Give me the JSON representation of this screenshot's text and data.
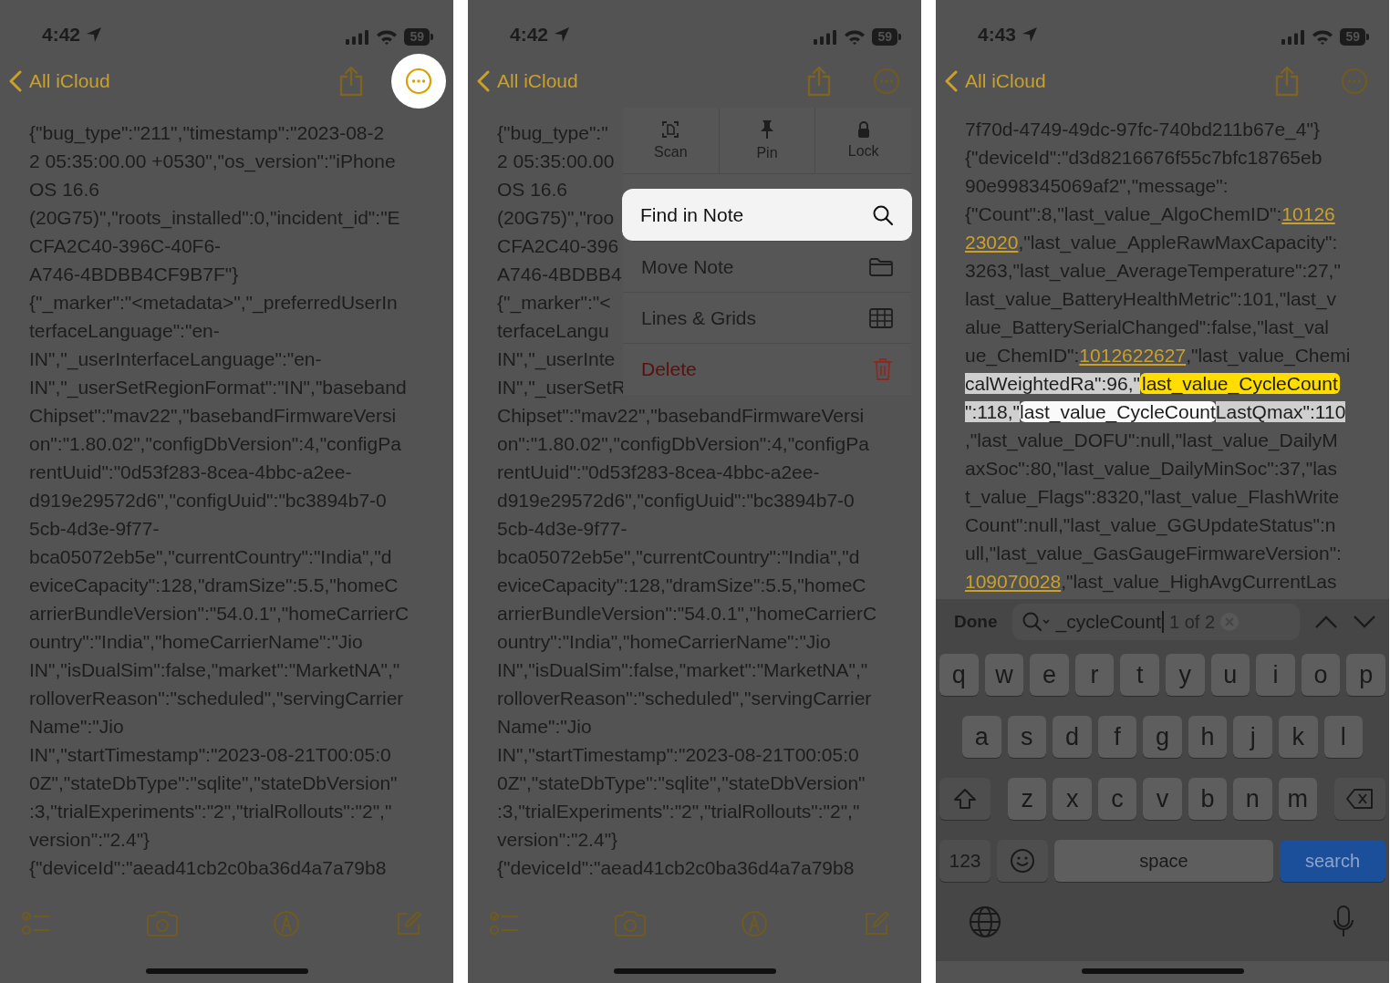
{
  "screens": [
    {
      "kind": "note",
      "status": {
        "time": "4:42",
        "battery": "59"
      },
      "nav": {
        "back": "All iCloud",
        "more_selected": true
      },
      "lines": [
        "{\"bug_type\":\"211\",\"timestamp\":\"2023-08-2",
        "2 05:35:00.00 +0530\",\"os_version\":\"iPhone",
        "OS 16.6",
        "(20G75)\",\"roots_installed\":0,\"incident_id\":\"E",
        "CFA2C40-396C-40F6-",
        "A746-4BDBB4CF9B7F\"}",
        "{\"_marker\":\"<metadata>\",\"_preferredUserIn",
        "terfaceLanguage\":\"en-",
        "IN\",\"_userInterfaceLanguage\":\"en-",
        "IN\",\"_userSetRegionFormat\":\"IN\",\"baseband",
        "Chipset\":\"mav22\",\"basebandFirmwareVersi",
        "on\":\"1.80.02\",\"configDbVersion\":4,\"configPa",
        "rentUuid\":\"0d53f283-8cea-4bbc-a2ee-",
        "d919e29572d6\",\"configUuid\":\"bc3894b7-0",
        "5cb-4d3e-9f77-",
        "bca05072eb5e\",\"currentCountry\":\"India\",\"d",
        "eviceCapacity\":128,\"dramSize\":5.5,\"homeC",
        "arrierBundleVersion\":\"54.0.1\",\"homeCarrierC",
        "ountry\":\"India\",\"homeCarrierName\":\"Jio",
        "IN\",\"isDualSim\":false,\"market\":\"MarketNA\",\"",
        "rolloverReason\":\"scheduled\",\"servingCarrier",
        "Name\":\"Jio",
        "IN\",\"startTimestamp\":\"2023-08-21T00:05:0",
        "0Z\",\"stateDbType\":\"sqlite\",\"stateDbVersion\"",
        ":3,\"trialExperiments\":\"2\",\"trialRollouts\":\"2\",\"",
        "version\":\"2.4\"}",
        "{\"deviceId\":\"aead41cb2c0ba36d4a7a79b8"
      ]
    },
    {
      "kind": "menu",
      "status": {
        "time": "4:42",
        "battery": "59"
      },
      "nav": {
        "back": "All iCloud",
        "more_selected": false
      },
      "lines": [
        "{\"bug_type\":\"",
        "2 05:35:00.00",
        "OS 16.6",
        "(20G75)\",\"roo",
        "CFA2C40-396",
        "A746-4BDBB4",
        "{\"_marker\":\"<",
        "terfaceLangu",
        "IN\",\"_userInte",
        "IN\",\"_userSetR",
        "Chipset\":\"mav22\",\"basebandFirmwareVersi",
        "on\":\"1.80.02\",\"configDbVersion\":4,\"configPa",
        "rentUuid\":\"0d53f283-8cea-4bbc-a2ee-",
        "d919e29572d6\",\"configUuid\":\"bc3894b7-0",
        "5cb-4d3e-9f77-",
        "bca05072eb5e\",\"currentCountry\":\"India\",\"d",
        "eviceCapacity\":128,\"dramSize\":5.5,\"homeC",
        "arrierBundleVersion\":\"54.0.1\",\"homeCarrierC",
        "ountry\":\"India\",\"homeCarrierName\":\"Jio",
        "IN\",\"isDualSim\":false,\"market\":\"MarketNA\",\"",
        "rolloverReason\":\"scheduled\",\"servingCarrier",
        "Name\":\"Jio",
        "IN\",\"startTimestamp\":\"2023-08-21T00:05:0",
        "0Z\",\"stateDbType\":\"sqlite\",\"stateDbVersion\"",
        ":3,\"trialExperiments\":\"2\",\"trialRollouts\":\"2\",\"",
        "version\":\"2.4\"}",
        "{\"deviceId\":\"aead41cb2c0ba36d4a7a79b8"
      ],
      "menu": {
        "actions": [
          {
            "label": "Scan",
            "kind": "scan"
          },
          {
            "label": "Pin",
            "kind": "pin"
          },
          {
            "label": "Lock",
            "kind": "lock"
          }
        ],
        "items": [
          {
            "label": "Find in Note",
            "kind": "search",
            "selected": true
          },
          {
            "label": "Move Note",
            "kind": "folder",
            "selected": false
          },
          {
            "label": "Lines & Grids",
            "kind": "grid",
            "selected": false
          },
          {
            "label": "Delete",
            "kind": "trash",
            "selected": false
          }
        ]
      }
    },
    {
      "kind": "find",
      "status": {
        "time": "4:43",
        "battery": "59"
      },
      "nav": {
        "back": "All iCloud",
        "more_selected": false
      },
      "lines": [
        [
          {
            "text": "7f70d-4749-49dc-97fc-740bd211b67e_4\"}",
            "kind": "plain"
          }
        ],
        [
          {
            "text": "{\"deviceId\":\"d3d8216676f55c7bfc18765eb",
            "kind": "plain"
          }
        ],
        [
          {
            "text": "90e998345069af2\",\"message\":",
            "kind": "plain"
          }
        ],
        [
          {
            "text": "{\"Count\":8,\"last_value_AlgoChemID\":",
            "kind": "plain"
          },
          {
            "text": "10126",
            "kind": "link"
          }
        ],
        [
          {
            "text": "23020",
            "kind": "link"
          },
          {
            "text": ",\"last_value_AppleRawMaxCapacity\":",
            "kind": "plain"
          }
        ],
        [
          {
            "text": "3263,\"last_value_AverageTemperature\":27,\"",
            "kind": "plain"
          }
        ],
        [
          {
            "text": "last_value_BatteryHealthMetric\":101,\"last_v",
            "kind": "plain"
          }
        ],
        [
          {
            "text": "alue_BatterySerialChanged\":false,\"last_val",
            "kind": "plain"
          }
        ],
        [
          {
            "text": "ue_ChemID\":",
            "kind": "plain"
          },
          {
            "text": "1012622627",
            "kind": "link"
          },
          {
            "text": ",\"last_value_Chemi",
            "kind": "plain"
          }
        ],
        [
          {
            "text": "calWeightedRa\":96,\"",
            "kind": "context"
          },
          {
            "text": "last_value_CycleCount",
            "kind": "current"
          }
        ],
        [
          {
            "text": "\":118,\"",
            "kind": "context"
          },
          {
            "text": "last_value_CycleCount",
            "kind": "match"
          },
          {
            "text": "LastQmax\":110",
            "kind": "context"
          }
        ],
        [
          {
            "text": ",\"last_value_DOFU\":null,\"last_value_DailyM",
            "kind": "plain"
          }
        ],
        [
          {
            "text": "axSoc\":80,\"last_value_DailyMinSoc\":37,\"las",
            "kind": "plain"
          }
        ],
        [
          {
            "text": "t_value_Flags\":8320,\"last_value_FlashWrite",
            "kind": "plain"
          }
        ],
        [
          {
            "text": "Count\":null,\"last_value_GGUpdateStatus\":n",
            "kind": "plain"
          }
        ],
        [
          {
            "text": "ull,\"last_value_GasGaugeFirmwareVersion\":",
            "kind": "plain"
          }
        ],
        [
          {
            "text": "109070028",
            "kind": "link"
          },
          {
            "text": ",\"last_value_HighAvgCurrentLas",
            "kind": "plain"
          }
        ]
      ],
      "find_bar": {
        "done": "Done",
        "query": "_cycleCount",
        "count": "1 of 2"
      },
      "keyboard": {
        "rows": [
          [
            "q",
            "w",
            "e",
            "r",
            "t",
            "y",
            "u",
            "i",
            "o",
            "p"
          ],
          [
            "a",
            "s",
            "d",
            "f",
            "g",
            "h",
            "j",
            "k",
            "l"
          ],
          [
            "z",
            "x",
            "c",
            "v",
            "b",
            "n",
            "m"
          ]
        ],
        "numbers": "123",
        "space": "space",
        "search": "search"
      }
    }
  ]
}
